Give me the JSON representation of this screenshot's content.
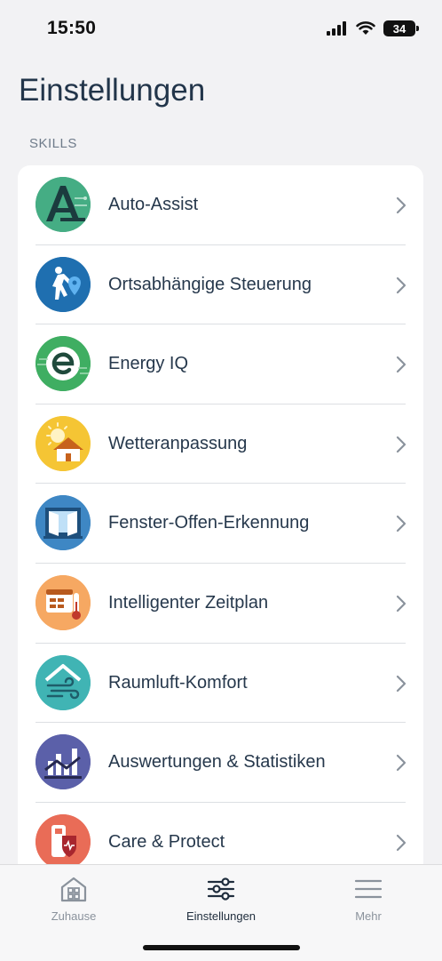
{
  "status": {
    "time": "15:50",
    "battery": "34"
  },
  "header": {
    "title": "Einstellungen"
  },
  "section": {
    "label": "SKILLS"
  },
  "skills": [
    {
      "label": "Auto-Assist",
      "icon": "auto-assist-icon",
      "color": "#3fa27a"
    },
    {
      "label": "Ortsabhängige Steuerung",
      "icon": "geofencing-icon",
      "color": "#1f6fb0"
    },
    {
      "label": "Energy IQ",
      "icon": "energy-iq-icon",
      "color": "#3aaa5e"
    },
    {
      "label": "Wetteranpassung",
      "icon": "weather-house-icon",
      "color": "#f2c12e"
    },
    {
      "label": "Fenster-Offen-Erkennung",
      "icon": "open-window-icon",
      "color": "#3b86c6"
    },
    {
      "label": "Intelligenter Zeitplan",
      "icon": "smart-schedule-icon",
      "color": "#f4a55b"
    },
    {
      "label": "Raumluft-Komfort",
      "icon": "air-comfort-icon",
      "color": "#3db3b3"
    },
    {
      "label": "Auswertungen & Statistiken",
      "icon": "statistics-icon",
      "color": "#5a5fa8"
    },
    {
      "label": "Care & Protect",
      "icon": "care-protect-icon",
      "color": "#e86a55"
    }
  ],
  "tabs": [
    {
      "label": "Zuhause",
      "icon": "home-icon",
      "active": false
    },
    {
      "label": "Einstellungen",
      "icon": "sliders-icon",
      "active": true
    },
    {
      "label": "Mehr",
      "icon": "menu-icon",
      "active": false
    }
  ]
}
